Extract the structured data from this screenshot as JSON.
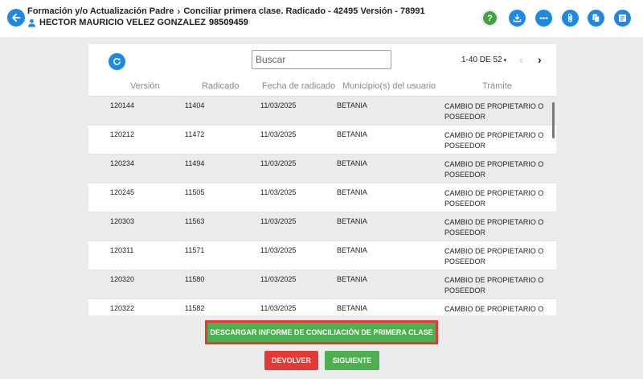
{
  "header": {
    "breadcrumb": [
      "Formación y/o Actualización Padre",
      "Conciliar primera clase. Radicado - 42495 Versión - 78991"
    ],
    "user_name": "HECTOR MAURICIO VELEZ GONZALEZ",
    "user_id": "98509459",
    "toolbar_icons": [
      "help-icon",
      "download-icon",
      "more-icon",
      "attach-icon",
      "copy-icon",
      "notes-icon"
    ],
    "help_glyph": "?"
  },
  "search": {
    "placeholder": "Buscar"
  },
  "pagination": {
    "label": "1-40 DE 52",
    "caret": "▾",
    "prev": "‹",
    "next": "›"
  },
  "table": {
    "columns": [
      "Versión",
      "Radicado",
      "Fecha de radicado",
      "Municipio(s) del usuario",
      "Trámite"
    ],
    "rows": [
      [
        "120144",
        "11404",
        "11/03/2025",
        "BETANIA",
        "CAMBIO DE PROPIETARIO O POSEEDOR"
      ],
      [
        "120212",
        "11472",
        "11/03/2025",
        "BETANIA",
        "CAMBIO DE PROPIETARIO O POSEEDOR"
      ],
      [
        "120234",
        "11494",
        "11/03/2025",
        "BETANIA",
        "CAMBIO DE PROPIETARIO O POSEEDOR"
      ],
      [
        "120245",
        "11505",
        "11/03/2025",
        "BETANIA",
        "CAMBIO DE PROPIETARIO O POSEEDOR"
      ],
      [
        "120303",
        "11563",
        "11/03/2025",
        "BETANIA",
        "CAMBIO DE PROPIETARIO O POSEEDOR"
      ],
      [
        "120311",
        "11571",
        "11/03/2025",
        "BETANIA",
        "CAMBIO DE PROPIETARIO O POSEEDOR"
      ],
      [
        "120320",
        "11580",
        "11/03/2025",
        "BETANIA",
        "CAMBIO DE PROPIETARIO O POSEEDOR"
      ],
      [
        "120322",
        "11582",
        "11/03/2025",
        "BETANIA",
        "CAMBIO DE PROPIETARIO O POSEEDOR"
      ]
    ]
  },
  "actions": {
    "report": "DESCARGAR INFORME DE CONCILIACIÓN DE PRIMERA CLASE",
    "devolver": "DEVOLVER",
    "siguiente": "SIGUIENTE"
  },
  "colors": {
    "primary": "#1e88e5",
    "success": "#4caf50",
    "danger": "#e53935"
  }
}
